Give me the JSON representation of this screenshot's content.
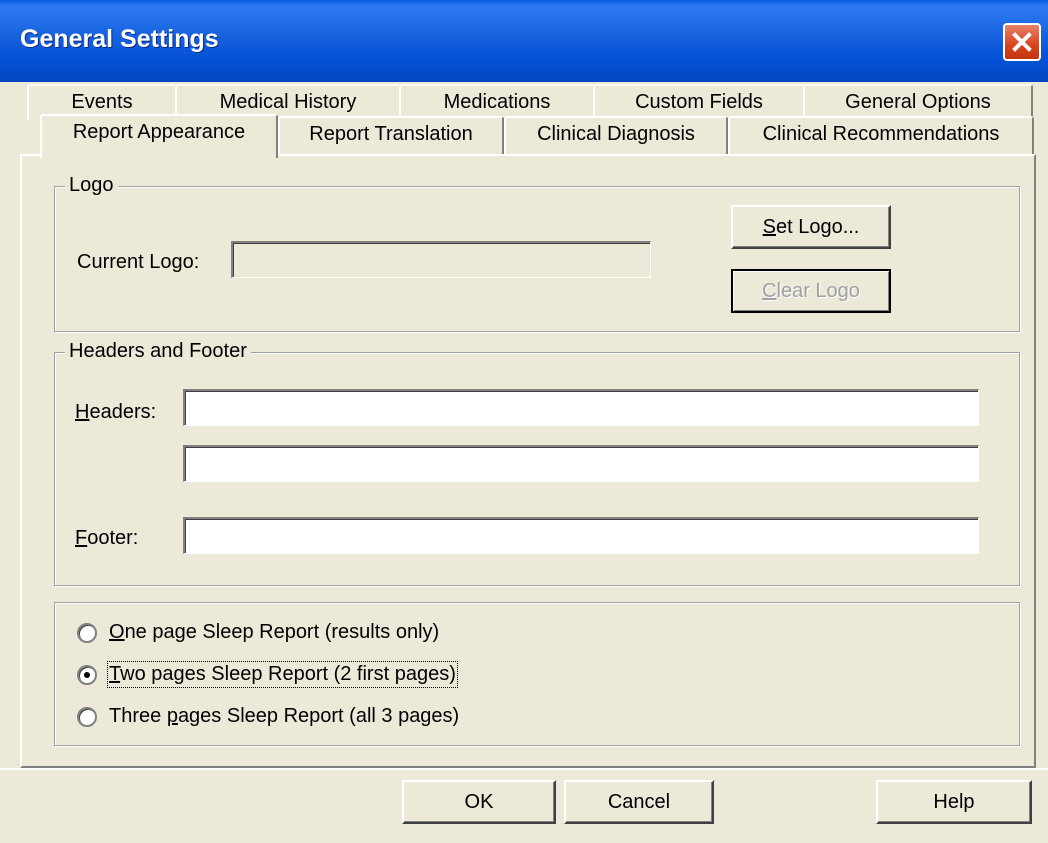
{
  "window": {
    "title": "General Settings"
  },
  "tabs": {
    "row1": [
      "Events",
      "Medical History",
      "Medications",
      "Custom Fields",
      "General Options"
    ],
    "row2": [
      "Report Appearance",
      "Report Translation",
      "Clinical Diagnosis",
      "Clinical Recommendations"
    ],
    "active": "Report Appearance"
  },
  "logo": {
    "group_label": "Logo",
    "current_label": "Current Logo:",
    "current_value": "",
    "set_button": {
      "accel": "S",
      "rest": "et Logo..."
    },
    "clear_button": {
      "accel": "C",
      "rest": "lear Logo"
    }
  },
  "headers": {
    "group_label": "Headers and Footer",
    "headers_label": {
      "accel": "H",
      "rest": "eaders:"
    },
    "header1_value": "",
    "header2_value": "",
    "footer_label": {
      "accel": "F",
      "rest": "ooter:"
    },
    "footer_value": ""
  },
  "report": {
    "options": [
      {
        "accel": "O",
        "rest": "ne page Sleep Report (results only)"
      },
      {
        "accel": "T",
        "rest": "wo pages Sleep Report (2 first pages)"
      },
      {
        "pre": "Three ",
        "accel": "p",
        "rest": "ages Sleep Report (all 3 pages)"
      }
    ],
    "selected_index": 1
  },
  "buttons": {
    "ok": "OK",
    "cancel": "Cancel",
    "help": "Help"
  }
}
